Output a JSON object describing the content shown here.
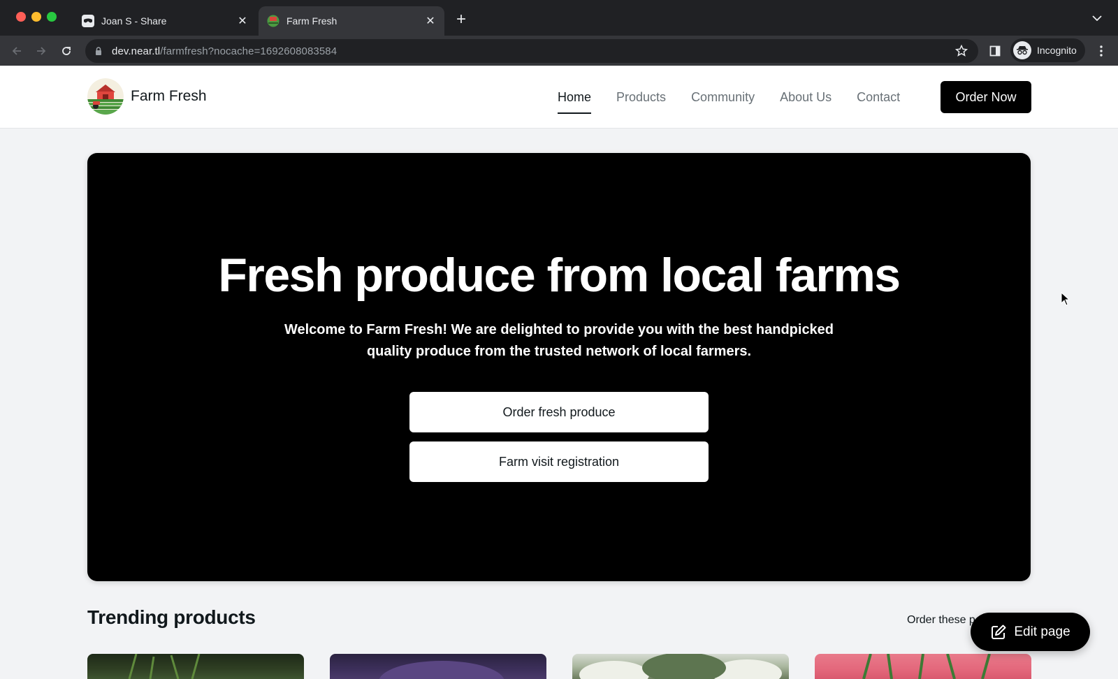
{
  "browser": {
    "tabs": [
      {
        "label": "Joan S - Share",
        "favicon": "mask-icon"
      },
      {
        "label": "Farm Fresh",
        "favicon": "farm-icon",
        "active": true
      }
    ],
    "url_host": "dev.near.tl",
    "url_path": "/farmfresh?nocache=1692608083584",
    "profile_label": "Incognito"
  },
  "header": {
    "brand_name": "Farm Fresh",
    "nav": [
      {
        "label": "Home",
        "active": true
      },
      {
        "label": "Products"
      },
      {
        "label": "Community"
      },
      {
        "label": "About Us"
      },
      {
        "label": "Contact"
      }
    ],
    "cta_label": "Order Now"
  },
  "hero": {
    "title": "Fresh produce from local farms",
    "subtitle": "Welcome to Farm Fresh! We are delighted to provide you with the best handpicked quality produce from the trusted network of local farmers.",
    "buttons": [
      "Order fresh produce",
      "Farm visit registration"
    ]
  },
  "trending": {
    "title": "Trending products",
    "link_text": "Order these p"
  },
  "edit_button": {
    "label": "Edit page"
  },
  "colors": {
    "chrome_bg": "#202124",
    "toolbar_bg": "#35363a",
    "accent": "#000000",
    "page_bg": "#f2f3f5",
    "nav_muted": "#687076"
  }
}
